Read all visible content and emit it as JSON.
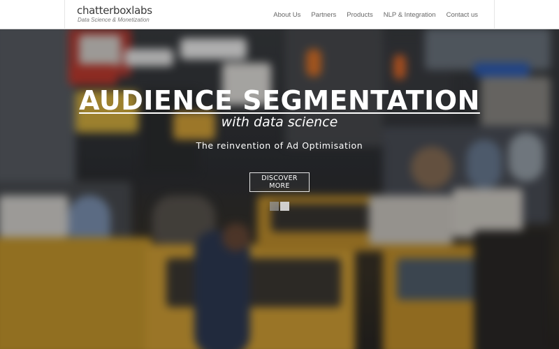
{
  "header": {
    "brand_name": "chatterboxlabs",
    "brand_tagline": "Data Science & Monetization",
    "nav": [
      "About Us",
      "Partners",
      "Products",
      "NLP & Integration",
      "Contact us"
    ]
  },
  "hero": {
    "headline": "AUDIENCE SEGMENTATION",
    "subheadline": "with data science",
    "tagline": "The reinvention of Ad Optimisation",
    "cta_label": "DISCOVER MORE",
    "slide_count": 2,
    "active_slide": 2
  },
  "colors": {
    "header_bg": "#ffffff",
    "hero_text": "#ffffff",
    "taxi_yellow": "#c99a2e"
  }
}
